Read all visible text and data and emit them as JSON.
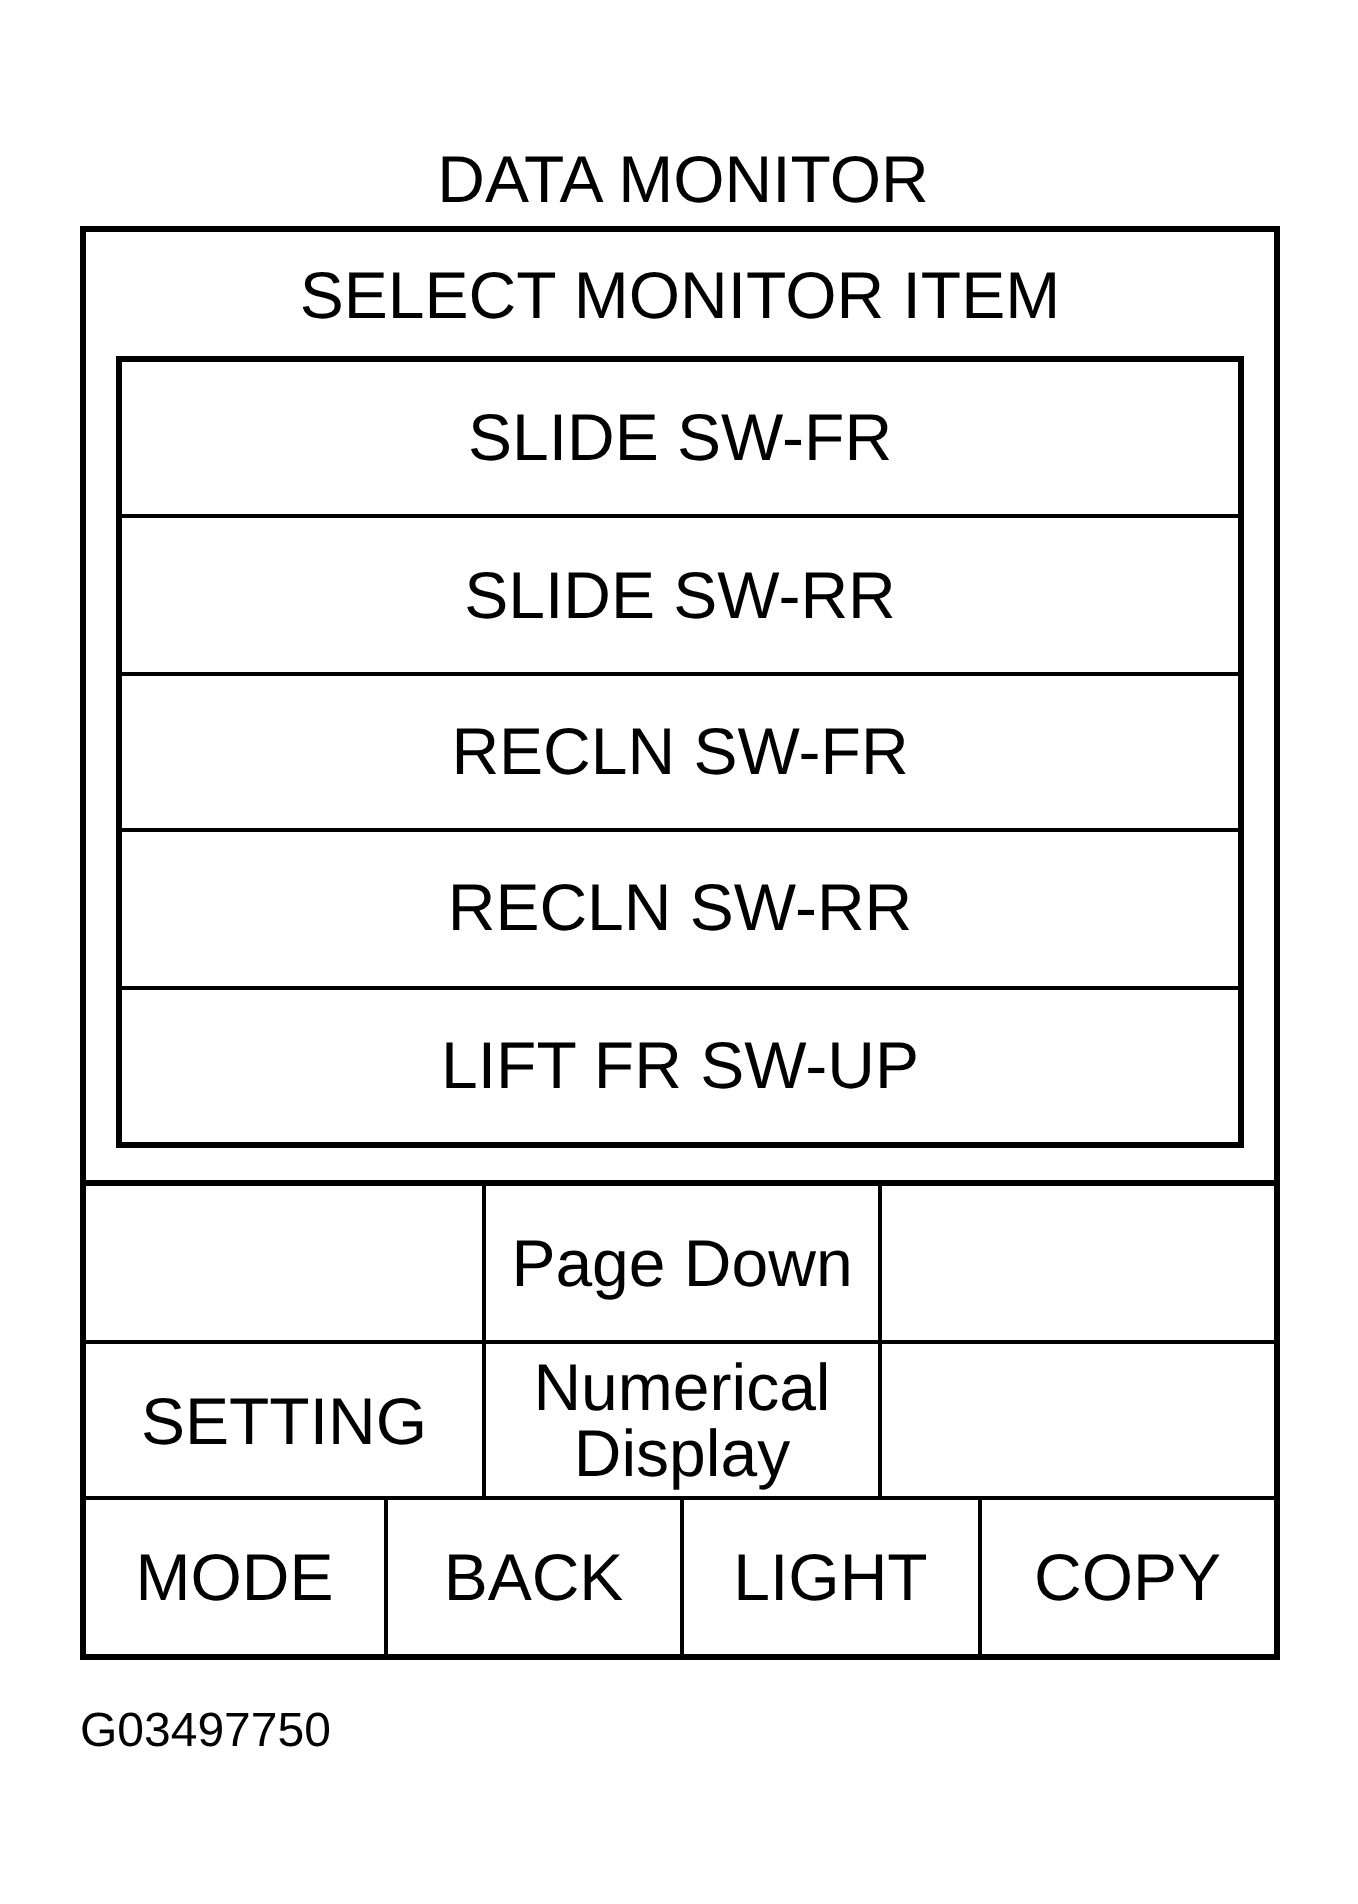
{
  "title": "DATA MONITOR",
  "screen": {
    "heading": "SELECT MONITOR ITEM",
    "items": [
      "SLIDE SW-FR",
      "SLIDE SW-RR",
      "RECLN SW-FR",
      "RECLN SW-RR",
      "LIFT FR SW-UP"
    ]
  },
  "key_rows": [
    {
      "keys": [
        {
          "kind": "blank"
        },
        {
          "kind": "key",
          "label": "Page Down"
        },
        {
          "kind": "blank"
        }
      ]
    },
    {
      "keys": [
        {
          "kind": "key",
          "label": "SETTING"
        },
        {
          "kind": "key",
          "label": "Numerical Display"
        },
        {
          "kind": "blank"
        }
      ]
    },
    {
      "keys": [
        {
          "kind": "key",
          "label": "MODE"
        },
        {
          "kind": "key",
          "label": "BACK"
        },
        {
          "kind": "key",
          "label": "LIGHT"
        },
        {
          "kind": "key",
          "label": "COPY"
        }
      ]
    }
  ],
  "figure_id": "G03497750"
}
